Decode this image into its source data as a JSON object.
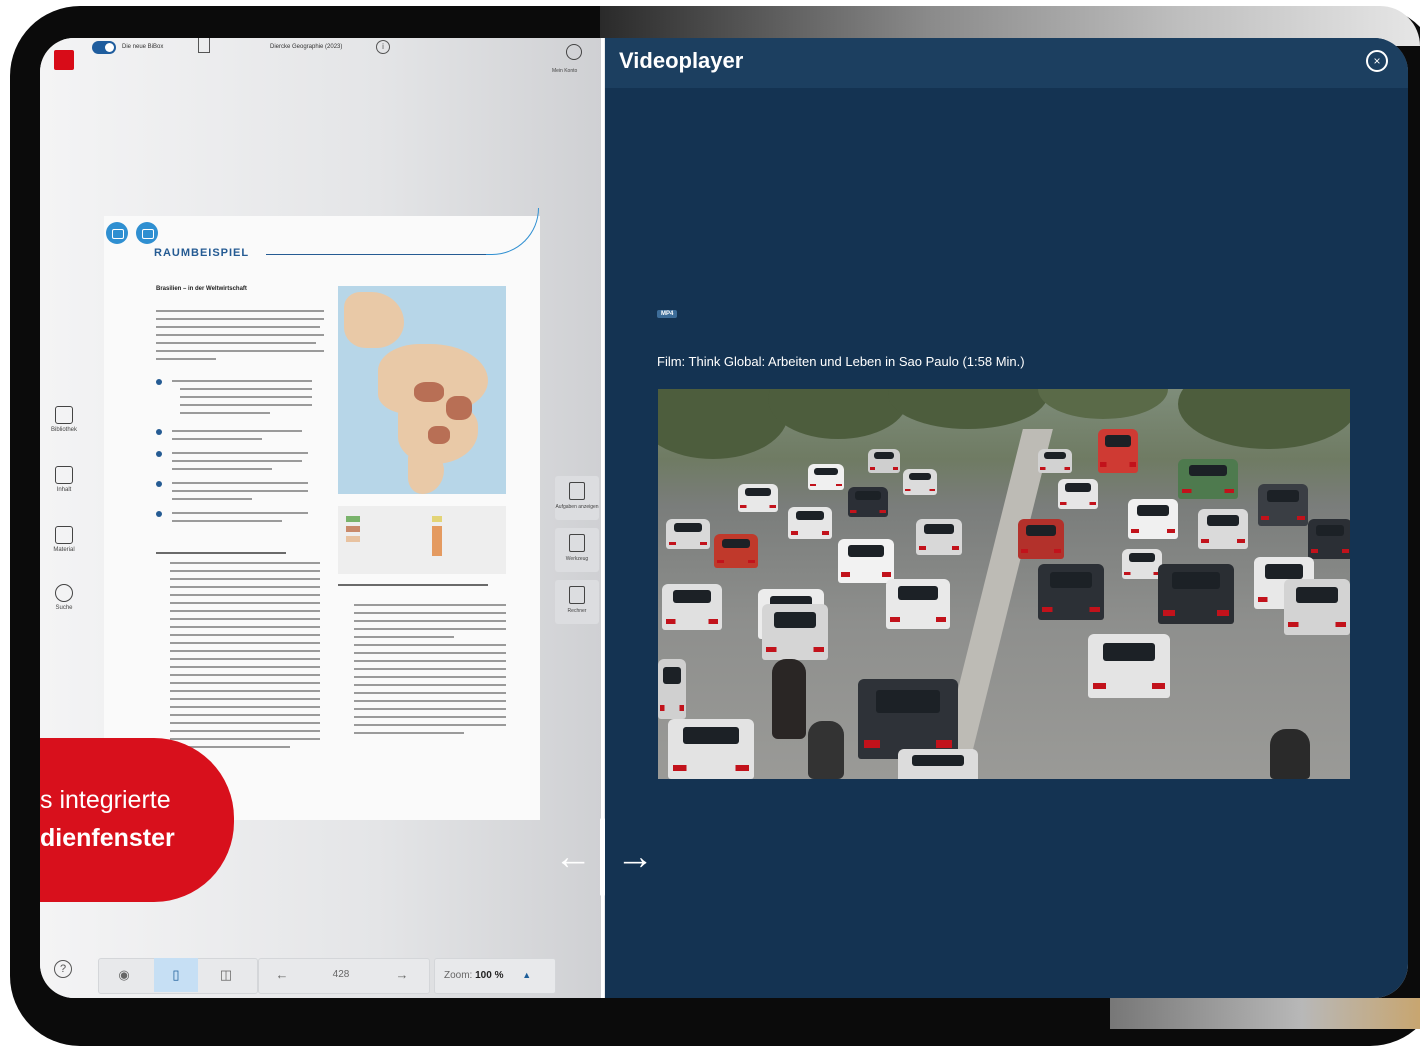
{
  "app": {
    "toggle_label": "Die neue BiBox",
    "book_title": "Diercke Geographie (2023)",
    "account_label": "Mein Konto",
    "info_glyph": "i"
  },
  "sidebar": {
    "items": [
      {
        "label": "Bibliothek",
        "icon": "library-icon"
      },
      {
        "label": "Inhalt",
        "icon": "contents-icon"
      },
      {
        "label": "Material",
        "icon": "material-icon"
      },
      {
        "label": "Suche",
        "icon": "search-icon"
      }
    ]
  },
  "book_page": {
    "section": "RAUMBEISPIEL",
    "subtitle": "Brasilien – in der Weltwirtschaft"
  },
  "right_tools": [
    {
      "label": "Aufgaben anzeigen",
      "icon": "edit-icon"
    },
    {
      "label": "Werkzeug",
      "icon": "tools-icon"
    },
    {
      "label": "Rechner",
      "icon": "calculator-icon"
    }
  ],
  "bottom_toolbar": {
    "help_glyph": "?",
    "eye_glyph": "◉",
    "single_page_glyph": "▯",
    "double_page_glyph": "◫",
    "prev_glyph": "←",
    "page_number": "428",
    "next_glyph": "→",
    "zoom_label": "Zoom:",
    "zoom_value": "100 %",
    "zoom_caret": "▲"
  },
  "callout": {
    "line1": "s integrierte",
    "line2": "dienfenster"
  },
  "resize_handle": {
    "left_arrow": "←",
    "right_arrow": "→"
  },
  "videoplayer": {
    "title": "Videoplayer",
    "close_glyph": "×",
    "format_badge": "MP4",
    "film_title": "Film: Think Global: Arbeiten und Leben in Sao Paulo (1:58 Min.)"
  },
  "colors": {
    "accent_red": "#d8101c",
    "player_bg": "#143352",
    "link_blue": "#255b93"
  }
}
